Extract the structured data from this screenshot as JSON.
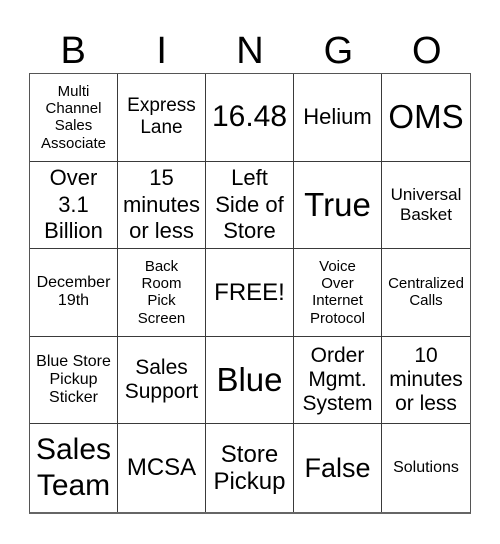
{
  "title_letters": [
    "B",
    "I",
    "N",
    "G",
    "O"
  ],
  "cells": [
    {
      "text": "Multi\nChannel\nSales\nAssociate",
      "size": "s15"
    },
    {
      "text": "Express\nLane",
      "size": "s19"
    },
    {
      "text": "16.48",
      "size": "s30"
    },
    {
      "text": "Helium",
      "size": "s22"
    },
    {
      "text": "OMS",
      "size": "s33"
    },
    {
      "text": "Over\n3.1\nBillion",
      "size": "s22"
    },
    {
      "text": "15\nminutes\nor less",
      "size": "s22"
    },
    {
      "text": "Left\nSide of\nStore",
      "size": "s22"
    },
    {
      "text": "True",
      "size": "s33"
    },
    {
      "text": "Universal\nBasket",
      "size": "s17"
    },
    {
      "text": "December\n19th",
      "size": "s16"
    },
    {
      "text": "Back\nRoom\nPick\nScreen",
      "size": "s15"
    },
    {
      "text": "FREE!",
      "size": "s24"
    },
    {
      "text": "Voice\nOver\nInternet\nProtocol",
      "size": "s15"
    },
    {
      "text": "Centralized\nCalls",
      "size": "s15"
    },
    {
      "text": "Blue Store\nPickup\nSticker",
      "size": "s16"
    },
    {
      "text": "Sales\nSupport",
      "size": "s21"
    },
    {
      "text": "Blue",
      "size": "s33"
    },
    {
      "text": "Order\nMgmt.\nSystem",
      "size": "s21"
    },
    {
      "text": "10\nminutes\nor less",
      "size": "s21"
    },
    {
      "text": "Sales\nTeam",
      "size": "s30"
    },
    {
      "text": "MCSA",
      "size": "s24"
    },
    {
      "text": "Store\nPickup",
      "size": "s24"
    },
    {
      "text": "False",
      "size": "s27"
    },
    {
      "text": "Solutions",
      "size": "s16"
    }
  ]
}
